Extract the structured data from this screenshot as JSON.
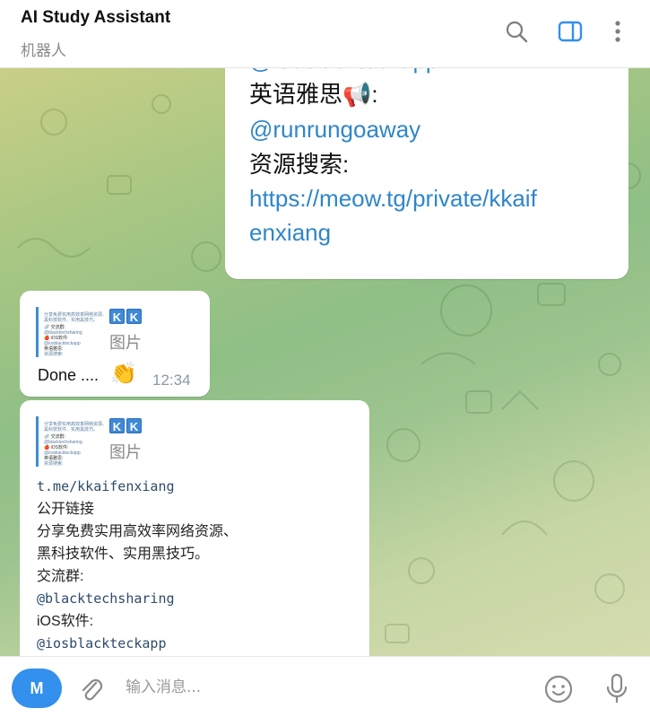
{
  "header": {
    "title": "AI Study Assistant",
    "subtitle": "机器人"
  },
  "messages": {
    "top": {
      "lines": [
        {
          "text": "@iosblackteckapp",
          "kind": "link"
        },
        {
          "text": "英语雅思📢:",
          "kind": "text"
        },
        {
          "text": "@runrungoaway",
          "kind": "link"
        },
        {
          "text": "资源搜索:",
          "kind": "text"
        },
        {
          "text": "https://meow.tg/private/kkaif",
          "kind": "link"
        },
        {
          "text": "enxiang",
          "kind": "link"
        }
      ]
    },
    "done_msg": {
      "kk": [
        "K",
        "K"
      ],
      "pic_label": "图片",
      "text": "Done ....",
      "emoji": "👏",
      "time": "12:34"
    },
    "channel_msg": {
      "kk": [
        "K",
        "K"
      ],
      "pic_label": "图片",
      "lines": [
        {
          "text": "t.me/kkaifenxiang",
          "kind": "mono"
        },
        {
          "text": "公开链接",
          "kind": "text"
        },
        {
          "text": "分享免费实用高效率网络资源、",
          "kind": "text"
        },
        {
          "text": "黑科技软件、实用黑技巧。",
          "kind": "text"
        },
        {
          "text": "交流群:",
          "kind": "text"
        },
        {
          "text": "@blacktechsharing",
          "kind": "mono"
        },
        {
          "text": "iOS软件:",
          "kind": "text"
        },
        {
          "text": "@iosblackteckapp",
          "kind": "mono"
        }
      ]
    }
  },
  "composer": {
    "avatar_letter": "M",
    "placeholder": "输入消息..."
  },
  "colors": {
    "accent": "#3390ec",
    "link": "#2f86c9"
  }
}
